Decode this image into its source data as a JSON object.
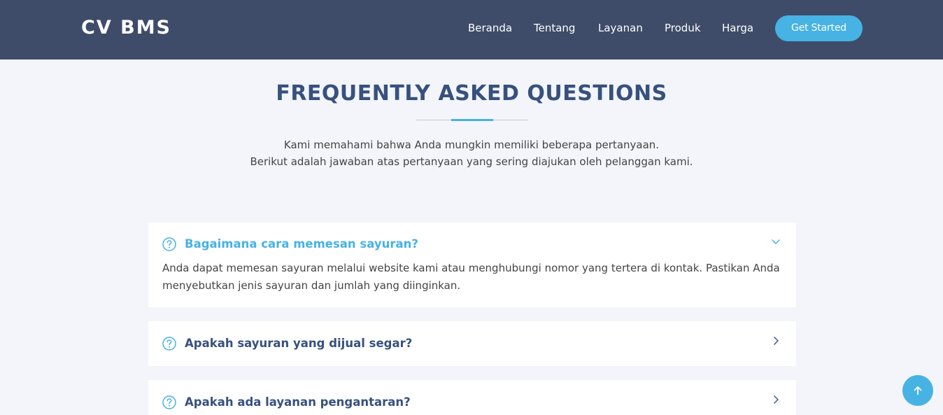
{
  "header": {
    "logo": "CV BMS",
    "nav": [
      "Beranda",
      "Tentang",
      "Layanan",
      "Produk",
      "Harga"
    ],
    "cta_label": "Get Started"
  },
  "faq_section": {
    "title": "FREQUENTLY ASKED QUESTIONS",
    "intro_line1": "Kami memahami bahwa Anda mungkin memiliki beberapa pertanyaan.",
    "intro_line2": "Berikut adalah jawaban atas pertanyaan yang sering diajukan oleh pelanggan kami.",
    "items": [
      {
        "question": "Bagaimana cara memesan sayuran?",
        "answer": "Anda dapat memesan sayuran melalui website kami atau menghubungi nomor yang tertera di kontak. Pastikan Anda menyebutkan jenis sayuran dan jumlah yang diinginkan.",
        "expanded": true
      },
      {
        "question": "Apakah sayuran yang dijual segar?",
        "expanded": false
      },
      {
        "question": "Apakah ada layanan pengantaran?",
        "expanded": false
      }
    ]
  },
  "colors": {
    "header_bg": "#3e4c69",
    "accent": "#47b2e4",
    "title": "#37517e",
    "page_bg": "#f3f5fa"
  },
  "icons": {
    "question": "question-circle-icon",
    "expanded": "chevron-down-icon",
    "collapsed": "chevron-right-icon",
    "back_to_top": "arrow-up-icon"
  }
}
